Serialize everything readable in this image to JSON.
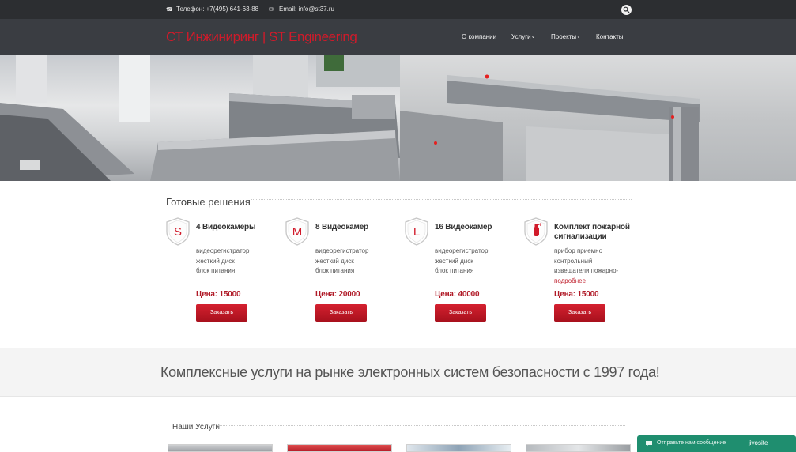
{
  "topbar": {
    "phone_label": "Телефон: +7(495) 641-63-88",
    "email_label": "Email: info@st37.ru",
    "phone_icon": "phone-icon",
    "email_icon": "envelope-icon",
    "search_icon": "search-icon"
  },
  "header": {
    "logo": "СТ Инжиниринг | ST Engineering",
    "nav": [
      {
        "label": "О компании",
        "has_dropdown": false
      },
      {
        "label": "Услуги",
        "has_dropdown": true
      },
      {
        "label": "Проекты",
        "has_dropdown": true
      },
      {
        "label": "Контакты",
        "has_dropdown": false
      }
    ],
    "caret": "˅"
  },
  "solutions": {
    "title": "Готовые решения",
    "products": [
      {
        "badge": "S",
        "name": "4 Видеокамеры",
        "features": [
          "видеорегистратор",
          "жесткий диск",
          "блок питания"
        ],
        "price": "Цена: 15000",
        "button": "Заказать"
      },
      {
        "badge": "M",
        "name": "8 Видеокамер",
        "features": [
          "видеорегистратор",
          "жесткий диск",
          "блок питания"
        ],
        "price": "Цена: 20000",
        "button": "Заказать"
      },
      {
        "badge": "L",
        "name": "16 Видеокамер",
        "features": [
          "видеорегистратор",
          "жесткий диск",
          "блок питания"
        ],
        "price": "Цена: 40000",
        "button": "Заказать"
      },
      {
        "badge": "fire",
        "badge_icon": "fire-extinguisher-icon",
        "name": "Комплект пожарной сигнализации",
        "features": [
          "прибор приемно",
          "контрольный",
          "извещатели пожарно-"
        ],
        "more": "подробнее",
        "price": "Цена: 15000",
        "button": "Заказать"
      }
    ]
  },
  "band": {
    "slogan": "Комплексные услуги на рынке электронных систем безопасности с 1997 года!"
  },
  "services": {
    "title": "Наши Услуги"
  },
  "chat": {
    "text": "Отправьте нам сообщение",
    "brand": "jivosite",
    "icon": "chat-bubble-icon"
  },
  "colors": {
    "brand_red": "#d11a2a",
    "topbar_bg": "#2c2e31",
    "header_bg": "#3a3d42",
    "chat_green": "#1f8e6f"
  }
}
